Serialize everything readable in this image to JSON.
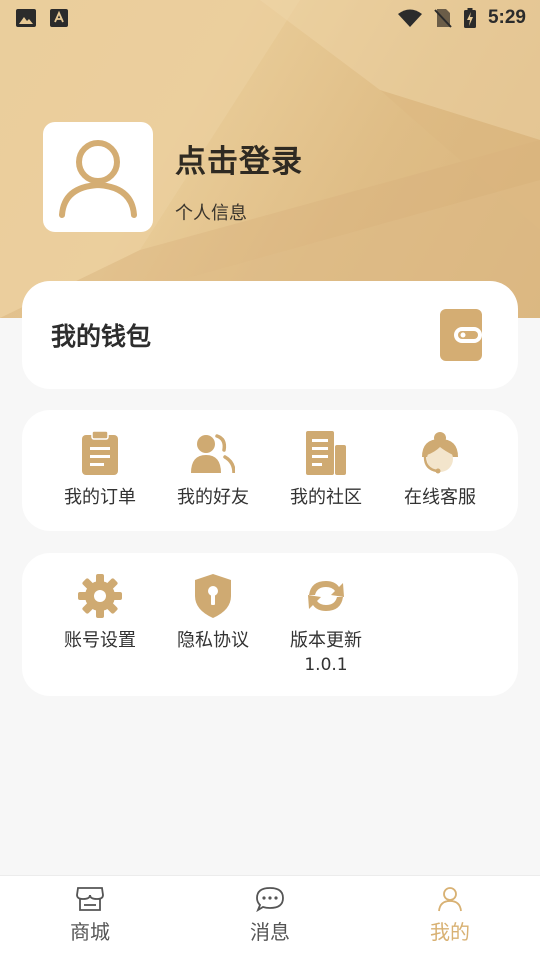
{
  "status_bar": {
    "time": "5:29",
    "left_icons": [
      "image-icon",
      "font-icon"
    ],
    "right_icons": [
      "wifi-icon",
      "no-sim-icon",
      "battery-charging-icon"
    ]
  },
  "profile": {
    "login_label": "点击登录",
    "info_label": "个人信息"
  },
  "wallet": {
    "title": "我的钱包",
    "icon": "wallet-icon"
  },
  "shortcuts": [
    {
      "label": "我的订单",
      "icon": "clipboard-icon"
    },
    {
      "label": "我的好友",
      "icon": "friends-icon"
    },
    {
      "label": "我的社区",
      "icon": "community-icon"
    },
    {
      "label": "在线客服",
      "icon": "customer-service-icon"
    }
  ],
  "settings": [
    {
      "label": "账号设置",
      "icon": "gear-icon"
    },
    {
      "label": "隐私协议",
      "icon": "shield-icon"
    },
    {
      "label": "版本更新",
      "icon": "refresh-icon",
      "version": "1.0.1"
    }
  ],
  "tabs": [
    {
      "label": "商城",
      "icon": "store-icon",
      "active": false
    },
    {
      "label": "消息",
      "icon": "message-icon",
      "active": false
    },
    {
      "label": "我的",
      "icon": "person-icon",
      "active": true
    }
  ],
  "colors": {
    "accent": "#d4ad73",
    "icon_gold": "#cfaa72",
    "header_gold": "#e7c995",
    "active_tab": "#d8b173",
    "background": "#f7f7f7"
  }
}
